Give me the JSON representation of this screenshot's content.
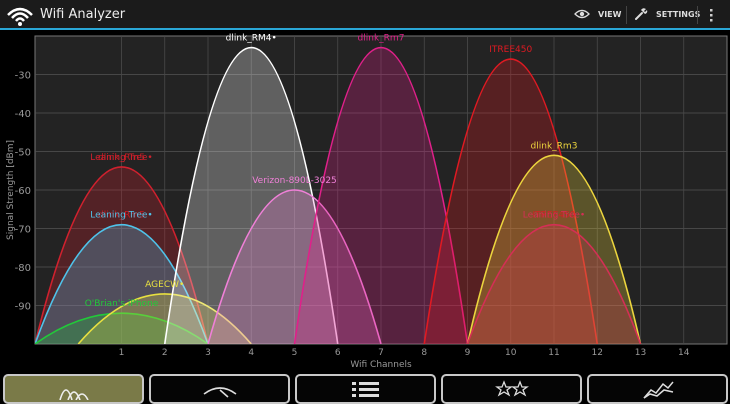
{
  "app": {
    "title": "Wifi Analyzer",
    "view_label": "VIEW",
    "settings_label": "SETTINGS"
  },
  "colors": {
    "background": "#000000",
    "plot_background": "#232323",
    "accent": "#2aa7d6",
    "tab_active": "#7a7a48"
  },
  "tabs": [
    {
      "name": "channel-graph",
      "icon": "channel-graph-icon",
      "active": true
    },
    {
      "name": "signal-meter",
      "icon": "signal-meter-icon",
      "active": false
    },
    {
      "name": "ap-list",
      "icon": "list-icon",
      "active": false
    },
    {
      "name": "channel-rating",
      "icon": "stars-icon",
      "active": false
    },
    {
      "name": "time-graph",
      "icon": "time-graph-icon",
      "active": false
    }
  ],
  "chart_data": {
    "type": "area",
    "xlabel": "Wifi Channels",
    "ylabel": "Signal Strength [dBm]",
    "xlim": [
      -1,
      15
    ],
    "ylim": [
      -100,
      -20
    ],
    "x_ticks": [
      "1",
      "2",
      "3",
      "4",
      "5",
      "6",
      "7",
      "8",
      "9",
      "10",
      "11",
      "12",
      "13",
      "14"
    ],
    "y_ticks": [
      "-30",
      "-40",
      "-50",
      "-60",
      "-70",
      "-80",
      "-90"
    ],
    "grid": true,
    "series": [
      {
        "name": "Leaning Tree•",
        "overlay": "dlink_Rm5",
        "channel": 1,
        "half_width": 2,
        "peak": -54,
        "color": "#d0212e"
      },
      {
        "name": "Leaning Tree•",
        "overlay": "dlink_Rm5",
        "channel": 1,
        "half_width": 2,
        "peak": -69,
        "color": "#4fc3ea"
      },
      {
        "name": "O'Brian's iPhone",
        "channel": 1,
        "half_width": 2,
        "peak": -92,
        "color": "#22c93a"
      },
      {
        "name": "AGECW•",
        "channel": 2,
        "half_width": 2,
        "peak": -87,
        "color": "#e8e040"
      },
      {
        "name": "dlink_RM4•",
        "channel": 4,
        "half_width": 2,
        "peak": -23,
        "color": "#ffffff"
      },
      {
        "name": "Verizon-890L-3025",
        "channel": 5,
        "half_width": 2,
        "peak": -60,
        "color": "#f080d8"
      },
      {
        "name": "dlink_Rm7",
        "channel": 7,
        "half_width": 2,
        "peak": -23,
        "color": "#e0208a"
      },
      {
        "name": "ITREE450",
        "channel": 10,
        "half_width": 2,
        "peak": -26,
        "color": "#e01a22"
      },
      {
        "name": "dlink_Rm3",
        "channel": 11,
        "half_width": 2,
        "peak": -51,
        "color": "#ecd53e"
      },
      {
        "name": "Leaning Tree•",
        "overlay": "ITREE450",
        "channel": 11,
        "half_width": 2,
        "peak": -69,
        "color": "#d42f55"
      }
    ]
  }
}
